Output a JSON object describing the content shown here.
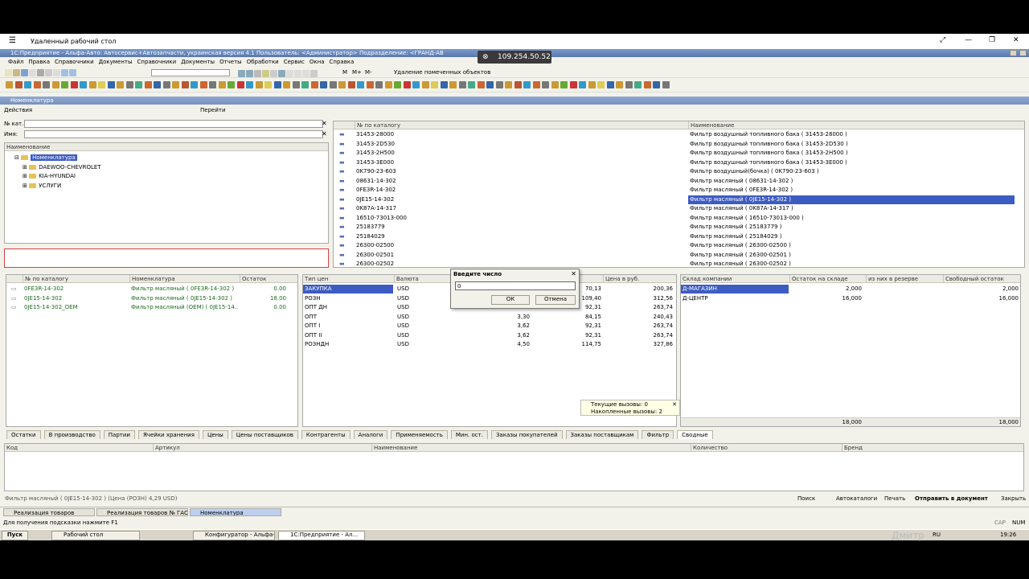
{
  "rdp": {
    "title": "Удаленный рабочий стол",
    "ip": "109.254.50.52"
  },
  "app": {
    "title": "1С:Предприятие - Альфа-Авто: Автосервис+Автозапчасти, украинская версия 4.1   Пользователь: <Администратор>   Подразделение: <ГРАНД-АВ",
    "menu": [
      "Файл",
      "Правка",
      "Справочники",
      "Документы",
      "Справочники",
      "Документы",
      "Отчеты",
      "Обработки",
      "Сервис",
      "Окна",
      "Справка"
    ],
    "toolbar_action": "Удаление помеченных объектов",
    "toolbar_m": [
      "M",
      "M+",
      "M-"
    ]
  },
  "doc": {
    "title": "Номенклатура",
    "actions": "Действия",
    "go": "Перейти",
    "filter_catalog_label": "№ кат.:",
    "filter_name_label": "Имя:",
    "tree_header": "Наименование",
    "tree": [
      "Номенклатура",
      "DAEWOO-CHEVROLET",
      "KIA-HYUNDAI",
      "УСЛУГИ"
    ]
  },
  "catalog": {
    "headers": [
      "№ по каталогу",
      "Наименование"
    ],
    "rows": [
      [
        "31453-28000",
        "Фильтр воздушный топливного бака ( 31453-28000 )"
      ],
      [
        "31453-2D530",
        "Фильтр воздушный топливного бака ( 31453-2D530 )"
      ],
      [
        "31453-2H500",
        "Фильтр воздушный топливного бака ( 31453-2H500 )"
      ],
      [
        "31453-3E000",
        "Фильтр воздушный топливного бака ( 31453-3E000 )"
      ],
      [
        "0K790-23-603",
        "Фильтр воздушный(бочка) ( 0K790-23-603 )"
      ],
      [
        "08631-14-302",
        "Фильтр масляный ( 08631-14-302 )"
      ],
      [
        "0FE3R-14-302",
        "Фильтр масляный ( 0FE3R-14-302 )"
      ],
      [
        "0JE15-14-302",
        "Фильтр масляный ( 0JE15-14-302 )"
      ],
      [
        "0K87A-14-317",
        "Фильтр масляный ( 0K87A-14-317 )"
      ],
      [
        "16510-73013-000",
        "Фильтр масляный ( 16510-73013-000 )"
      ],
      [
        "25183779",
        "Фильтр масляный ( 25183779 )"
      ],
      [
        "25184029",
        "Фильтр масляный ( 25184029 )"
      ],
      [
        "26300-02500",
        "Фильтр масляный ( 26300-02500 )"
      ],
      [
        "26300-02501",
        "Фильтр масляный ( 26300-02501 )"
      ],
      [
        "26300-02502",
        "Фильтр масляный ( 26300-02502 )"
      ]
    ],
    "selected_index": 7
  },
  "analogs": {
    "headers": [
      "№ по каталогу",
      "Номенклатура",
      "Остаток"
    ],
    "rows": [
      [
        "0FE3R-14-302",
        "Фильтр масляный ( 0FE3R-14-302 )",
        "0.00"
      ],
      [
        "0JE15-14-302",
        "Фильтр масляный ( 0JE15-14-302 )",
        "18.00"
      ],
      [
        "0JE15-14-302_OEM",
        "Фильтр масляный (OEM) ( 0JE15-14...",
        "0.00"
      ]
    ]
  },
  "prices": {
    "headers": [
      "Тип цен",
      "Валюта",
      "",
      "",
      "Цена в руб."
    ],
    "rows": [
      [
        "ЗАКУПКА",
        "USD",
        "",
        "70,13",
        "200,36"
      ],
      [
        "РОЗН",
        "USD",
        "",
        "109,40",
        "312,56"
      ],
      [
        "ОПТ ДН",
        "USD",
        "",
        "92,31",
        "263,74"
      ],
      [
        "ОПТ",
        "USD",
        "3,30",
        "84,15",
        "240,43"
      ],
      [
        "ОПТ I",
        "USD",
        "3,62",
        "92,31",
        "263,74"
      ],
      [
        "ОПТ II",
        "USD",
        "3,62",
        "92,31",
        "263,74"
      ],
      [
        "РОЗНДН",
        "USD",
        "4,50",
        "114,75",
        "327,86"
      ]
    ]
  },
  "stock": {
    "headers": [
      "Склад компании",
      "Остаток на складе",
      "из них в резерве",
      "Свободный остаток"
    ],
    "rows": [
      [
        "Д-МАГАЗИН",
        "2,000",
        "",
        "2,000"
      ],
      [
        "Д-ЦЕНТР",
        "16,000",
        "",
        "16,000"
      ]
    ],
    "totals": [
      "18,000",
      "18,000"
    ]
  },
  "dialog": {
    "title": "Введите число",
    "value": "0",
    "ok": "ОК",
    "cancel": "Отмена"
  },
  "calls": {
    "current": "Текущие вызовы: 0",
    "accum": "Накопленные вызовы: 2"
  },
  "tabs": [
    "Остатки",
    "В производство",
    "Партии",
    "Ячейки хранения",
    "Цены",
    "Цены поставщиков",
    "Контрагенты",
    "Аналоги",
    "Применяемость",
    "Мин. ост.",
    "Заказы покупателей",
    "Заказы поставщикам",
    "Фильтр",
    "Сводные"
  ],
  "bottom": {
    "headers": [
      "Код",
      "Артикул",
      "Наименование",
      "Количество",
      "Бренд"
    ],
    "status_line": "Фильтр масляный ( 0JE15-14-302 ) (Цена (РОЗН) 4,29 USD)",
    "search": "Поиск",
    "autocat": "Автокаталоги",
    "print": "Печать",
    "send": "Отправить в документ",
    "close": "Закрыть"
  },
  "windows": [
    "Реализация товаров",
    "Реализация товаров № ГАО...",
    "Номенклатура"
  ],
  "status": {
    "hint": "Для получения подсказки нажмите F1",
    "cap": "CAP",
    "num": "NUM"
  },
  "taskbar": {
    "start": "Пуск",
    "items": [
      "Рабочий стол",
      "Конфигуратор - Альфа-...",
      "1С:Предприятие - Ал..."
    ],
    "lang": "RU",
    "time": "19:26",
    "watermark": "Дмитр"
  }
}
